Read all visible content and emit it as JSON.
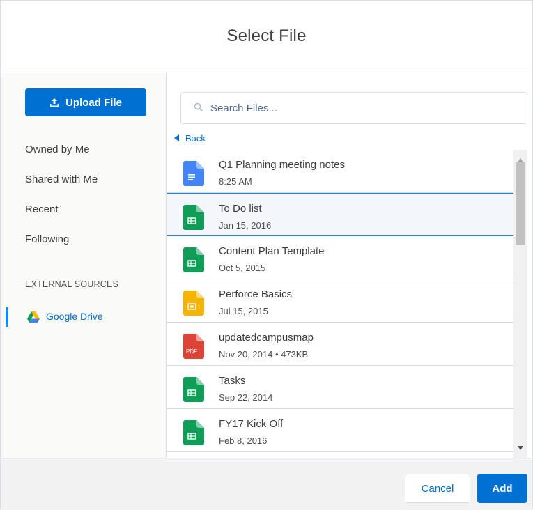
{
  "header": {
    "title": "Select File"
  },
  "sidebar": {
    "upload_label": "Upload File",
    "nav": [
      {
        "label": "Owned by Me"
      },
      {
        "label": "Shared with Me"
      },
      {
        "label": "Recent"
      },
      {
        "label": "Following"
      }
    ],
    "external_heading": "EXTERNAL SOURCES",
    "external_sources": [
      {
        "label": "Google Drive",
        "icon": "google-drive-icon",
        "active": true
      }
    ]
  },
  "search": {
    "placeholder": "Search Files...",
    "value": ""
  },
  "back_label": "Back",
  "files": [
    {
      "name": "Q1 Planning meeting notes",
      "meta": "8:25 AM",
      "type": "doc",
      "icon_color": "#4285f4"
    },
    {
      "name": "To Do list",
      "meta": "Jan 15, 2016",
      "type": "sheet",
      "icon_color": "#0f9d58",
      "selected": true
    },
    {
      "name": "Content Plan Template",
      "meta": "Oct 5, 2015",
      "type": "sheet",
      "icon_color": "#0f9d58"
    },
    {
      "name": "Perforce Basics",
      "meta": "Jul 15, 2015",
      "type": "slides",
      "icon_color": "#f4b400"
    },
    {
      "name": "updatedcampusmap",
      "meta": "Nov 20, 2014 • 473KB",
      "type": "pdf",
      "icon_color": "#db4437",
      "badge": "PDF"
    },
    {
      "name": "Tasks",
      "meta": "Sep 22, 2014",
      "type": "sheet",
      "icon_color": "#0f9d58"
    },
    {
      "name": "FY17 Kick Off",
      "meta": "Feb 8, 2016",
      "type": "sheet",
      "icon_color": "#0f9d58"
    }
  ],
  "footer": {
    "cancel_label": "Cancel",
    "add_label": "Add"
  },
  "colors": {
    "brand": "#0070d2",
    "selected_border": "#1589ee"
  }
}
